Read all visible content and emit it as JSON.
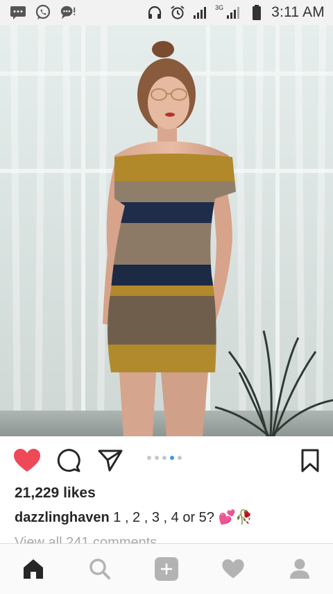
{
  "status_bar": {
    "time": "3:11 AM",
    "network": "3G",
    "icons": [
      "message-icon",
      "whatsapp-icon",
      "chat-bubble-icon",
      "headphones-icon",
      "alarm-icon",
      "signal-icon",
      "signal-3g-icon",
      "battery-icon"
    ]
  },
  "post": {
    "image": "photo-woman-striped-dress",
    "carousel": {
      "count": 5,
      "active_index": 3
    },
    "likes": "21,229 likes",
    "username": "dazzlinghaven",
    "caption_text": "1 , 2 , 3 , 4 or 5? 💕🥀",
    "comments_link": "View all 241 comments",
    "like_color": "#ed4956"
  },
  "bottom_nav": {
    "items": [
      "home-icon",
      "search-icon",
      "add-post-icon",
      "activity-heart-icon",
      "profile-icon"
    ],
    "active": "home-icon"
  },
  "colors": {
    "accent_blue": "#3897f0",
    "text": "#262626",
    "muted": "#a8a8a8"
  }
}
